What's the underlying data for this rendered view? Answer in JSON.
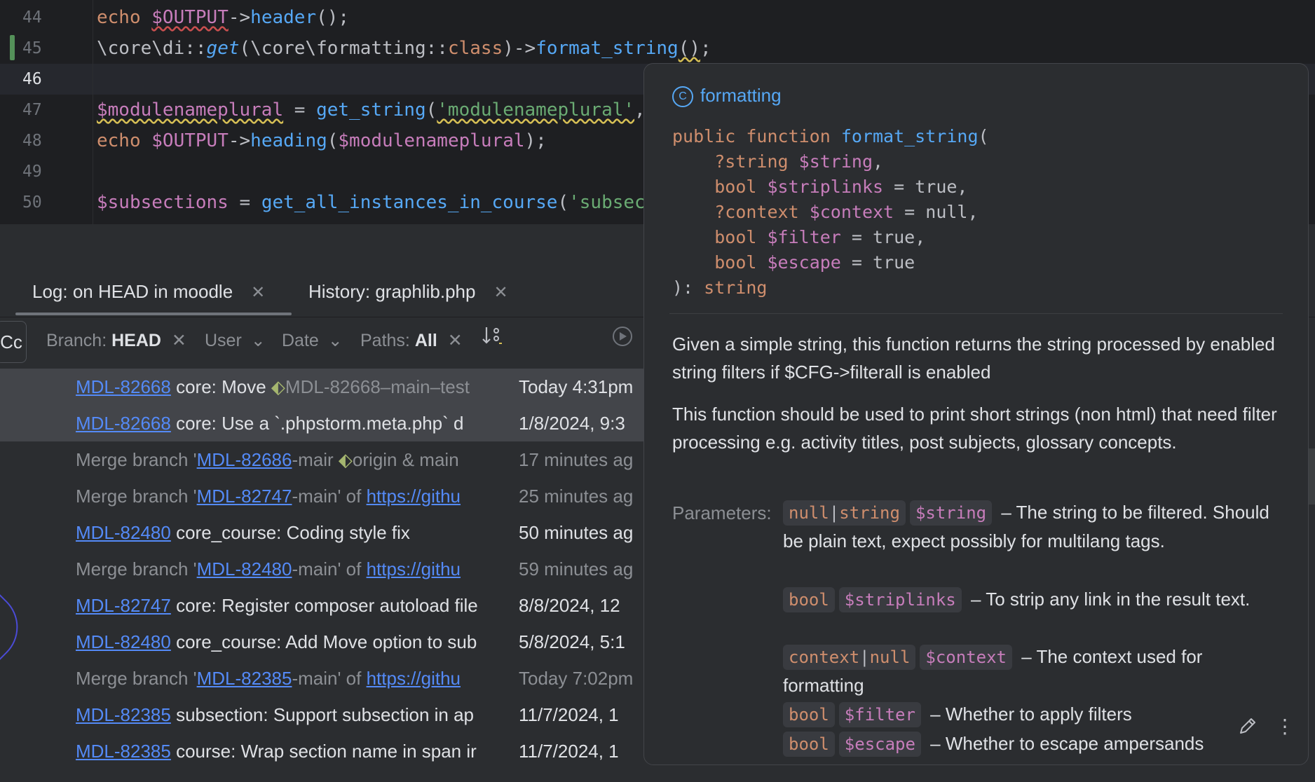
{
  "editor": {
    "lines": [
      {
        "num": "44"
      },
      {
        "num": "45"
      },
      {
        "num": "46"
      },
      {
        "num": "47"
      },
      {
        "num": "48"
      },
      {
        "num": "49"
      },
      {
        "num": "50"
      }
    ],
    "code": {
      "l44": {
        "a": "echo",
        "b": "$OUTPUT",
        "c": "->",
        "d": "header",
        "e": "();"
      },
      "l45": {
        "a": "\\core\\",
        "b": "di",
        "c": "::",
        "d": "get",
        "e": "(\\core\\",
        "f": "formatting",
        "g": "::",
        "h": "class",
        "i": ")->",
        "j": "format_string",
        "k": "()",
        "l": ";"
      },
      "l47": {
        "a": "$modulenameplural",
        "b": " = ",
        "c": "get_string",
        "d": "(",
        "e": "'modulenameplural'",
        "f": ","
      },
      "l48": {
        "a": "echo",
        "b": "$OUTPUT",
        "c": "->",
        "d": "heading",
        "e": "(",
        "f": "$modulenameplural",
        "g": ");"
      },
      "l50": {
        "a": "$subsections",
        "b": " = ",
        "c": "get_all_instances_in_course",
        "d": "(",
        "e": "'subsec"
      }
    }
  },
  "tabs": [
    {
      "label": "Log: on HEAD in moodle"
    },
    {
      "label": "History: graphlib.php"
    }
  ],
  "filters": {
    "cc": "Cc",
    "branch_label": "Branch:",
    "branch_value": "HEAD",
    "user": "User",
    "date": "Date",
    "paths_label": "Paths:",
    "paths_value": "All"
  },
  "commits": [
    {
      "id": "MDL-82668",
      "text": " core: Move ",
      "tag": "MDL-82668–main–test",
      "date": "Today 4:31pm"
    },
    {
      "id": "MDL-82668",
      "text": " core: Use a `.phpstorm.meta.php` d",
      "date": "1/8/2024, 9:3"
    },
    {
      "pre": "Merge branch '",
      "id": "MDL-82686",
      "post": "-mair",
      "tag": "origin & main",
      "date": "17 minutes ag"
    },
    {
      "pre": "Merge branch '",
      "id": "MDL-82747",
      "post": "-main' of ",
      "url": "https://githu",
      "date": "25 minutes ag"
    },
    {
      "id": "MDL-82480",
      "text": " core_course: Coding style fix",
      "date": "50 minutes ag"
    },
    {
      "pre": "Merge branch '",
      "id": "MDL-82480",
      "post": "-main' of ",
      "url": "https://githu",
      "date": "59 minutes ag"
    },
    {
      "id": "MDL-82747",
      "text": " core: Register composer autoload file",
      "date": "8/8/2024, 12"
    },
    {
      "id": "MDL-82480",
      "text": " core_course: Add Move option to sub",
      "date": "5/8/2024, 5:1"
    },
    {
      "pre": "Merge branch '",
      "id": "MDL-82385",
      "post": "-main' of ",
      "url": "https://githu",
      "date": "Today 7:02pm"
    },
    {
      "id": "MDL-82385",
      "text": " subsection: Support subsection in ap",
      "date": "11/7/2024, 1"
    },
    {
      "id": "MDL-82385",
      "text": " course: Wrap section name in span ir",
      "date": "11/7/2024, 1"
    }
  ],
  "popup": {
    "class_name": "formatting",
    "icon_glyph": "C",
    "sig": {
      "kw1": "public function ",
      "fname": "format_string",
      "open": "(",
      "p1t": "?string",
      "p1v": "$string",
      "p1e": ",",
      "p2t": "bool",
      "p2v": "$striplinks",
      "p2e": " = true,",
      "p3t": "?context",
      "p3v": "$context",
      "p3e": " = null,",
      "p4t": "bool",
      "p4v": "$filter",
      "p4e": " = true,",
      "p5t": "bool",
      "p5v": "$escape",
      "p5e": " = true",
      "close": "): ",
      "ret": "string"
    },
    "desc1": "Given a simple string, this function returns the string processed by enabled string filters if $CFG->filterall is enabled",
    "desc2": "This function should be used to print short strings (non html) that need filter processing e.g. activity titles, post subjects, glossary concepts.",
    "params_label": "Parameters:",
    "params": [
      {
        "t1": "null",
        "sep": "|",
        "t2": "string",
        "var": "$string",
        "desc": " – The string to be filtered. Should be plain text, expect possibly for multilang tags."
      },
      {
        "t1": "bool",
        "var": "$striplinks",
        "desc": " – To strip any link in the result text."
      },
      {
        "t1": "context",
        "sep": "|",
        "t2": "null",
        "var": "$context",
        "desc": " – The context used for formatting"
      },
      {
        "t1": "bool",
        "var": "$filter",
        "desc": " – Whether to apply filters"
      },
      {
        "t1": "bool",
        "var": "$escape",
        "desc": " – Whether to escape ampersands"
      }
    ],
    "more_glyph": "⋮"
  },
  "colors": {
    "accent_link": "#548af7",
    "keyword": "#cf8e6d",
    "variable": "#c77dbb",
    "function": "#56a8f5",
    "string": "#6aab73"
  }
}
